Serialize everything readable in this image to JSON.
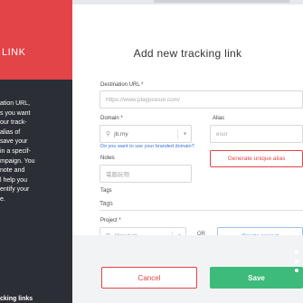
{
  "sidebar": {
    "title": "LINK",
    "description": "ation URL,\ns you want\nour track-\nalias of\nsave your\nin a specif-\nmpaign. You\nnote and\nl help you\nentify your\ne.",
    "footer": "cking links"
  },
  "modal": {
    "title": "Add new tracking link",
    "destination": {
      "label": "Destination URL *",
      "placeholder": "https://www.playpcesor.com/"
    },
    "domain": {
      "label": "Domain *",
      "value": "jb.my",
      "hint": "Do you want to use your branded domain?"
    },
    "alias": {
      "label": "Alias",
      "value": "esor",
      "generate_label": "Generate unique alias"
    },
    "notes": {
      "label": "Notes",
      "value": "電腦玩物"
    },
    "tags": {
      "label": "Tags",
      "value": "Tags"
    },
    "project": {
      "label": "Project *",
      "value": "課程專用",
      "or_text": "OR",
      "create_label": "Create project"
    },
    "actions": {
      "cancel_label": "Cancel",
      "save_label": "Save"
    }
  },
  "colors": {
    "accent_red": "#e24448",
    "save_green": "#3dbb7a",
    "link_blue": "#3a6fd8"
  }
}
